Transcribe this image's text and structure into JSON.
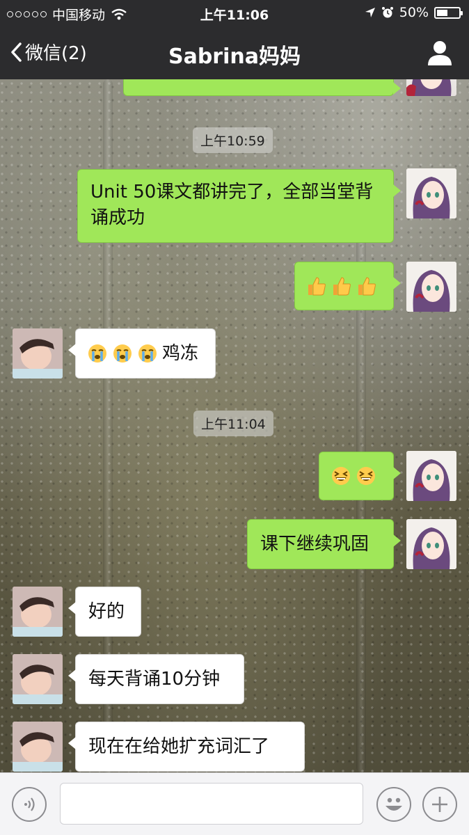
{
  "status_bar": {
    "carrier": "中国移动",
    "time": "上午11:06",
    "battery": "50%",
    "battery_level": 0.5
  },
  "nav": {
    "back_label": "微信(2)",
    "title": "Sabrina妈妈",
    "profile_icon": "person-icon"
  },
  "messages": {
    "ts1": "上午10:59",
    "m1": "Unit 50课文都讲完了，全部当堂背诵成功",
    "m2_emoji": [
      "thumbs-up",
      "thumbs-up",
      "thumbs-up"
    ],
    "m3_emoji": [
      "crying-face",
      "crying-face",
      "crying-face"
    ],
    "m3_text": "鸡冻",
    "ts2": "上午11:04",
    "m4_emoji": [
      "grinning-squint-face",
      "grinning-squint-face"
    ],
    "m5": "课下继续巩固",
    "m6": "好的",
    "m7": "每天背诵10分钟",
    "m8": "现在在给她扩充词汇了"
  },
  "input_bar": {
    "voice_icon": "voice-icon",
    "emoji_icon": "smiley-icon",
    "more_icon": "plus-icon",
    "input_value": ""
  },
  "colors": {
    "sent_bubble": "#a0e759",
    "received_bubble": "#ffffff",
    "bar_background": "#2c2c2e"
  }
}
